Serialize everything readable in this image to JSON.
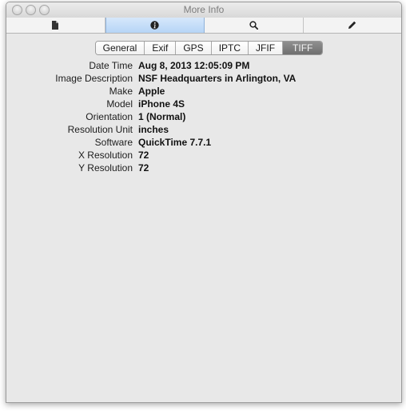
{
  "window": {
    "title": "More Info"
  },
  "toolbar": {
    "tools": [
      {
        "icon": "document-icon",
        "glyph": "▮"
      },
      {
        "icon": "info-icon",
        "glyph": "i"
      },
      {
        "icon": "search-icon",
        "glyph": "⌕"
      },
      {
        "icon": "pencil-icon",
        "glyph": "✎"
      }
    ],
    "active_index": 1
  },
  "tabs": {
    "items": [
      "General",
      "Exif",
      "GPS",
      "IPTC",
      "JFIF",
      "TIFF"
    ],
    "selected": "TIFF"
  },
  "properties": [
    {
      "label": "Date Time",
      "value": "Aug 8, 2013 12:05:09 PM"
    },
    {
      "label": "Image Description",
      "value": "NSF Headquarters in Arlington, VA"
    },
    {
      "label": "Make",
      "value": "Apple"
    },
    {
      "label": "Model",
      "value": "iPhone 4S"
    },
    {
      "label": "Orientation",
      "value": "1 (Normal)"
    },
    {
      "label": "Resolution Unit",
      "value": "inches"
    },
    {
      "label": "Software",
      "value": "QuickTime 7.7.1"
    },
    {
      "label": "X Resolution",
      "value": "72"
    },
    {
      "label": "Y Resolution",
      "value": "72"
    }
  ],
  "colors": {
    "selected_tool": "#b6d5f6",
    "selected_tab": "#7a7a7a",
    "panel_background": "#e8e8e8"
  }
}
